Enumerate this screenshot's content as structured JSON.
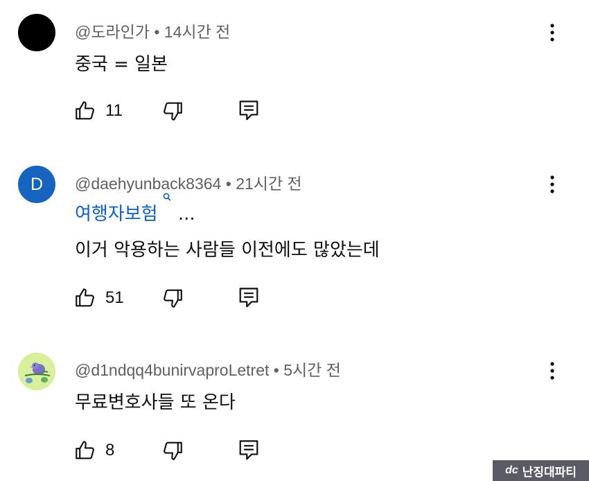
{
  "comments": [
    {
      "author": "@도라인가",
      "time": "14시간 전",
      "link_text": "",
      "text": "중국 = 일본",
      "likes": "11",
      "avatar_letter": ""
    },
    {
      "author": "@daehyunback8364",
      "time": "21시간 전",
      "link_text": "여행자보험",
      "link_ellipsis": "...",
      "text": "이거 악용하는 사람들 이전에도 많았는데",
      "likes": "51",
      "avatar_letter": "D"
    },
    {
      "author": "@d1ndqq4bunirvaproLetret",
      "time": "5시간 전",
      "link_text": "",
      "text": "무료변호사들 또 온다",
      "likes": "8",
      "avatar_letter": ""
    }
  ],
  "separator": "•",
  "watermark": {
    "logo": "dc",
    "text": "난징대파티"
  },
  "icons": {
    "like": "thumbs-up-icon",
    "dislike": "thumbs-down-icon",
    "reply": "reply-icon",
    "more": "more-vert-icon",
    "search": "search-icon"
  },
  "colors": {
    "link": "#065fd4",
    "meta": "#606060",
    "avatar_blue": "#1565c0",
    "avatar_bird_bg": "#d8ef9c"
  }
}
